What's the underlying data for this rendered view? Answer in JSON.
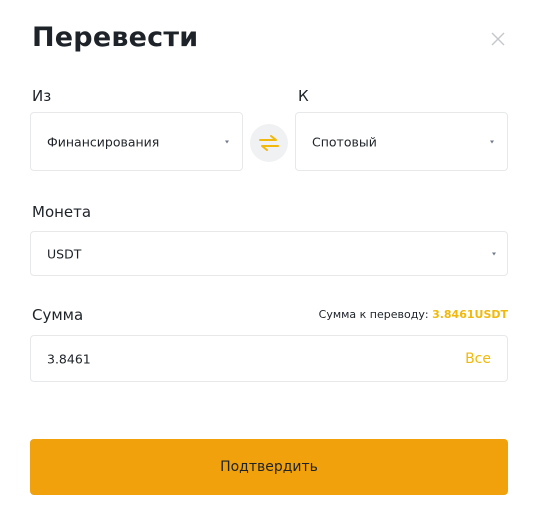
{
  "dialog": {
    "title": "Перевести",
    "close_icon": "close-icon"
  },
  "from": {
    "label": "Из",
    "value": "Финансирования"
  },
  "to": {
    "label": "К",
    "value": "Спотовый"
  },
  "swap_icon": "swap-arrows-icon",
  "coin": {
    "label": "Монета",
    "value": "USDT"
  },
  "amount": {
    "label": "Сумма",
    "available_label": "Сумма к переводу:",
    "available_value": "3.8461USDT",
    "value": "3.8461",
    "all_label": "Все"
  },
  "confirm_label": "Подтвердить",
  "colors": {
    "accent": "#f0b90b",
    "button": "#f0a10b",
    "text": "#1e2329",
    "muted": "#707a8a",
    "border": "#e6e8ea"
  }
}
